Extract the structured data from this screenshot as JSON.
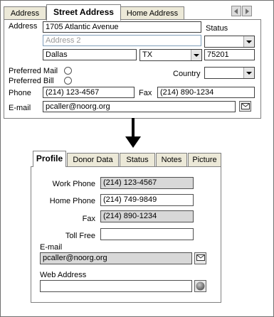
{
  "top": {
    "tabs": [
      "Address",
      "Street Address",
      "Home Address"
    ],
    "address_label": "Address",
    "address1": "1705 Atlantic Avenue",
    "address2_placeholder": "Address 2",
    "status_label": "Status",
    "status_value": "",
    "city": "Dallas",
    "state": "TX",
    "zip": "75201",
    "preferred_mail": "Preferred Mail",
    "preferred_bill": "Preferred Bill",
    "country_label": "Country",
    "country_value": "",
    "phone_label": "Phone",
    "phone": "(214) 123-4567",
    "fax_label": "Fax",
    "fax": "(214) 890-1234",
    "email_label": "E-mail",
    "email": "pcaller@noorg.org"
  },
  "bottom": {
    "tabs": [
      "Profile",
      "Donor Data",
      "Status",
      "Notes",
      "Picture"
    ],
    "work_phone_label": "Work Phone",
    "work_phone": "(214) 123-4567",
    "home_phone_label": "Home Phone",
    "home_phone": "(214) 749-9849",
    "fax_label": "Fax",
    "fax": "(214) 890-1234",
    "toll_free_label": "Toll Free",
    "toll_free": "",
    "email_label": "E-mail",
    "email": "pcaller@noorg.org",
    "web_label": "Web Address",
    "web": ""
  }
}
